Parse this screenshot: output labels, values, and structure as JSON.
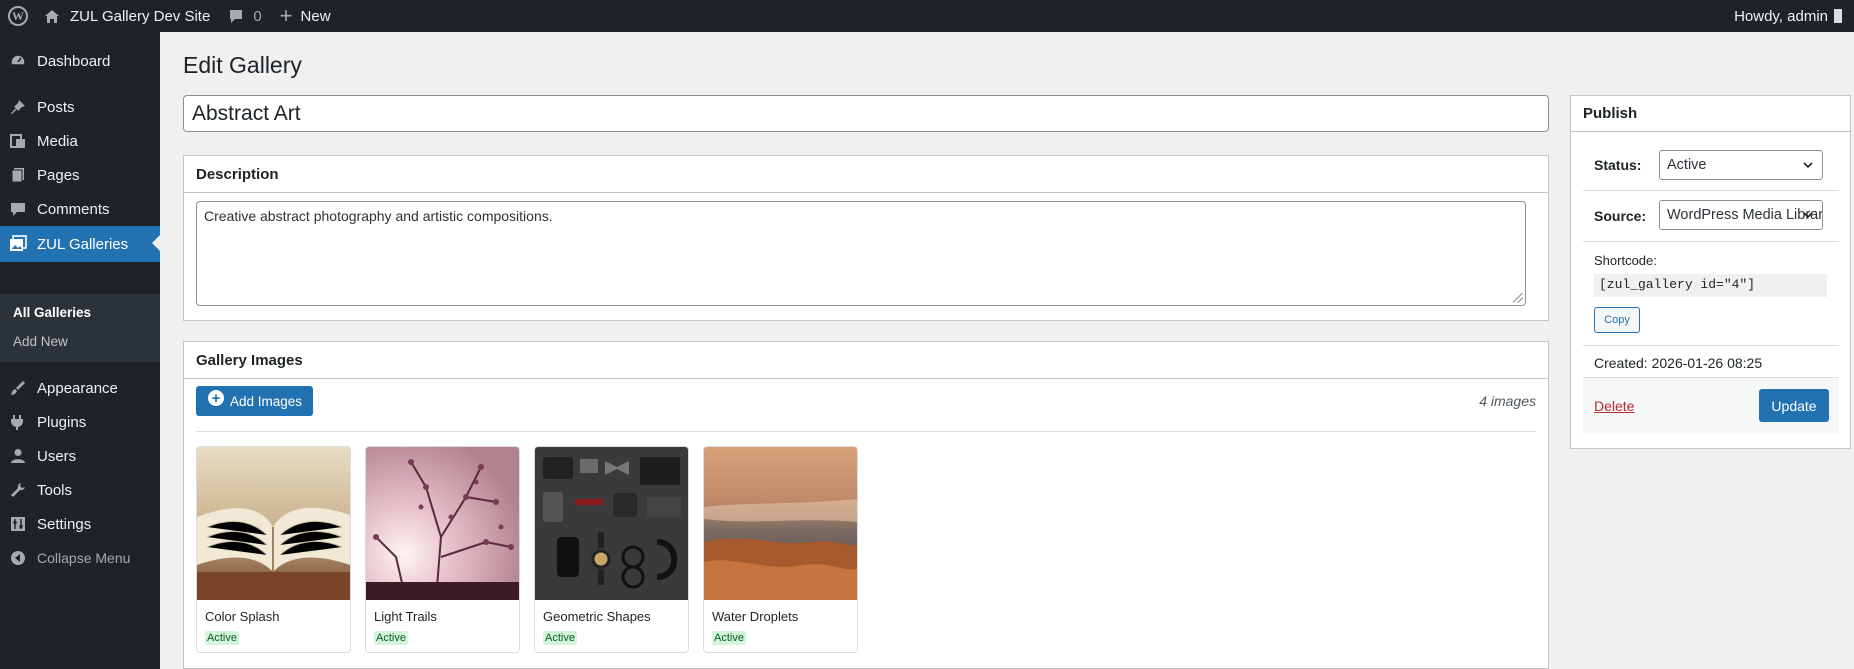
{
  "admin_bar": {
    "site_name": "ZUL Gallery Dev Site",
    "comments_count": "0",
    "new_label": "New",
    "howdy": "Howdy, admin"
  },
  "sidebar": {
    "items": [
      {
        "label": "Dashboard",
        "icon": "dashboard-icon"
      },
      {
        "label": "Posts",
        "icon": "pin-icon"
      },
      {
        "label": "Media",
        "icon": "media-icon"
      },
      {
        "label": "Pages",
        "icon": "pages-icon"
      },
      {
        "label": "Comments",
        "icon": "comment-icon"
      },
      {
        "label": "ZUL Galleries",
        "icon": "gallery-icon"
      },
      {
        "label": "Appearance",
        "icon": "brush-icon"
      },
      {
        "label": "Plugins",
        "icon": "plug-icon"
      },
      {
        "label": "Users",
        "icon": "user-icon"
      },
      {
        "label": "Tools",
        "icon": "wrench-icon"
      },
      {
        "label": "Settings",
        "icon": "settings-icon"
      }
    ],
    "submenu": [
      "All Galleries",
      "Add New"
    ],
    "collapse": "Collapse Menu"
  },
  "page": {
    "title": "Edit Gallery",
    "gallery_title": "Abstract Art"
  },
  "description": {
    "heading": "Description",
    "text": "Creative abstract photography and artistic compositions."
  },
  "gallery": {
    "heading": "Gallery Images",
    "add_button": "Add Images",
    "count": "4 images",
    "images": [
      {
        "name": "Color Splash",
        "status": "Active"
      },
      {
        "name": "Light Trails",
        "status": "Active"
      },
      {
        "name": "Geometric Shapes",
        "status": "Active"
      },
      {
        "name": "Water Droplets",
        "status": "Active"
      }
    ]
  },
  "publish": {
    "heading": "Publish",
    "status_label": "Status:",
    "status_value": "Active",
    "source_label": "Source:",
    "source_value": "WordPress Media Library",
    "shortcode_label": "Shortcode:",
    "shortcode": "[zul_gallery id=\"4\"]",
    "copy": "Copy",
    "created": "Created: 2026-01-26 08:25",
    "delete": "Delete",
    "update": "Update"
  },
  "colors": {
    "accent": "#2271b1",
    "adminbar": "#1d2327",
    "active_badge": "#d4f4dc",
    "delete": "#b32d2e"
  }
}
